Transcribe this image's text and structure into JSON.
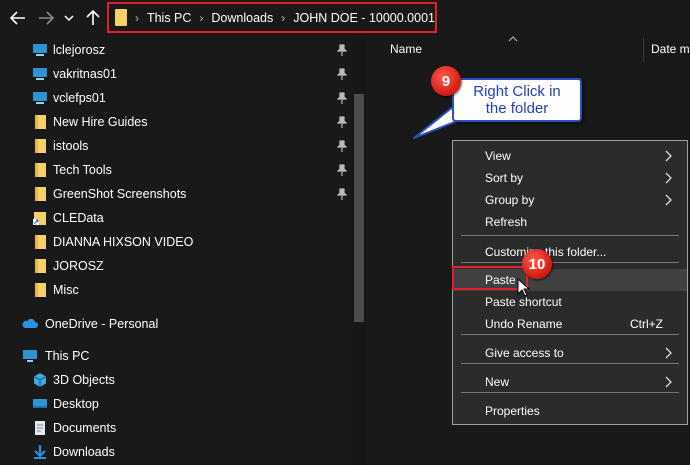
{
  "address": {
    "back_icon": "arrow-left-icon",
    "forward_icon": "arrow-right-icon",
    "recent_icon": "chevron-down-icon",
    "up_icon": "arrow-up-icon",
    "crumbs": [
      "This PC",
      "Downloads",
      "JOHN DOE - 10000.0001"
    ]
  },
  "nav": {
    "items": [
      {
        "label": "lclejorosz",
        "icon": "monitor-icon",
        "pinned": true
      },
      {
        "label": "vakritnas01",
        "icon": "monitor-icon",
        "pinned": true
      },
      {
        "label": "vclefps01",
        "icon": "monitor-icon",
        "pinned": true
      },
      {
        "label": "New Hire Guides",
        "icon": "folder-icon",
        "pinned": true
      },
      {
        "label": "istools",
        "icon": "folder-icon",
        "pinned": true
      },
      {
        "label": "Tech Tools",
        "icon": "folder-icon",
        "pinned": true
      },
      {
        "label": "GreenShot Screenshots",
        "icon": "folder-icon",
        "pinned": true
      },
      {
        "label": "CLEData",
        "icon": "shortcut-folder-icon",
        "pinned": false
      },
      {
        "label": "DIANNA HIXSON VIDEO",
        "icon": "folder-icon",
        "pinned": false
      },
      {
        "label": "JOROSZ",
        "icon": "folder-icon",
        "pinned": false
      },
      {
        "label": "Misc",
        "icon": "folder-icon",
        "pinned": false
      }
    ],
    "onedrive": "OneDrive - Personal",
    "thispc": "This PC",
    "pc_items": [
      {
        "label": "3D Objects",
        "icon": "cube-icon"
      },
      {
        "label": "Desktop",
        "icon": "desktop-icon"
      },
      {
        "label": "Documents",
        "icon": "documents-icon"
      },
      {
        "label": "Downloads",
        "icon": "downloads-icon"
      }
    ]
  },
  "content": {
    "col_name": "Name",
    "col_date": "Date m"
  },
  "callout": {
    "step": "9",
    "text_line1": "Right Click in",
    "text_line2": "the folder"
  },
  "menu": {
    "items": [
      {
        "label": "View",
        "submenu": true
      },
      {
        "label": "Sort by",
        "submenu": true
      },
      {
        "label": "Group by",
        "submenu": true
      },
      {
        "label": "Refresh",
        "submenu": false
      },
      {
        "label": "Customize this folder...",
        "submenu": false
      },
      {
        "label": "Paste",
        "submenu": false
      },
      {
        "label": "Paste shortcut",
        "submenu": false
      },
      {
        "label": "Undo Rename",
        "submenu": false,
        "shortcut": "Ctrl+Z"
      },
      {
        "label": "Give access to",
        "submenu": true
      },
      {
        "label": "New",
        "submenu": true
      },
      {
        "label": "Properties",
        "submenu": false
      }
    ],
    "step": "10"
  },
  "colors": {
    "highlight_red": "#e0202a",
    "callout_blue": "#2242b8",
    "folder_yellow": "#f5cf67"
  }
}
